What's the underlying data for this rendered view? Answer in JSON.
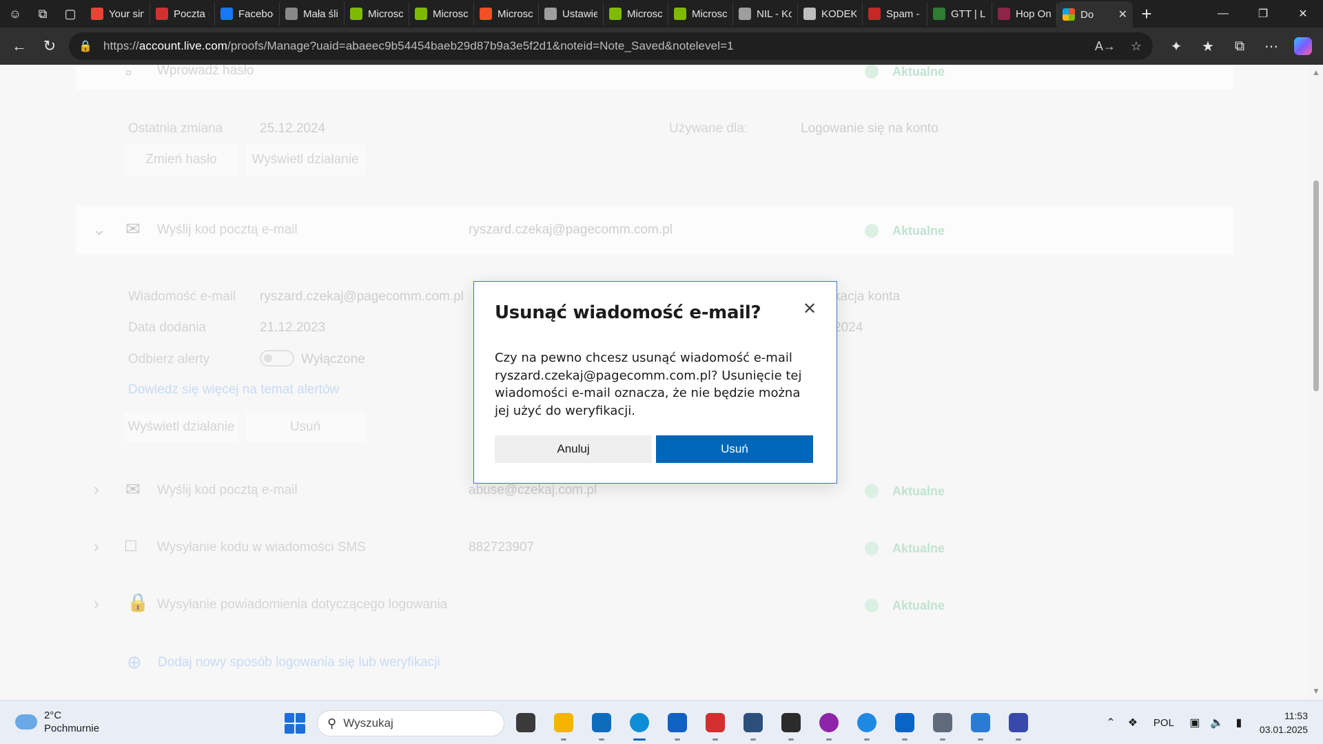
{
  "browser": {
    "tabs": [
      {
        "title": "Your sin",
        "color": "#ea4335"
      },
      {
        "title": "Poczta -",
        "color": "#d32f2f"
      },
      {
        "title": "Faceboo",
        "color": "#1877f2"
      },
      {
        "title": "Mała śli",
        "color": "#888888"
      },
      {
        "title": "Microsc",
        "color": "#7fba00"
      },
      {
        "title": "Microsc",
        "color": "#7fba00"
      },
      {
        "title": "Microsc",
        "color": "#f25022"
      },
      {
        "title": "Ustawie",
        "color": "#9e9e9e"
      },
      {
        "title": "Microsc",
        "color": "#7fba00"
      },
      {
        "title": "Microsc",
        "color": "#7fba00"
      },
      {
        "title": "NIL - Ko",
        "color": "#9e9e9e"
      },
      {
        "title": "KODEKS",
        "color": "#bdbdbd"
      },
      {
        "title": "Spam -",
        "color": "#c62828"
      },
      {
        "title": "GTT | Le",
        "color": "#2e7d32"
      },
      {
        "title": "Hop On",
        "color": "#8e2447"
      }
    ],
    "active_tab": {
      "title": "Do"
    },
    "url_prefix": "https://",
    "url_host": "account.live.com",
    "url_rest": "/proofs/Manage?uaid=abaeec9b54454baeb29d87b9a3e5f2d1&noteid=Note_Saved&notelevel=1"
  },
  "page": {
    "password_row": {
      "label": "Wprowadź hasło",
      "status": "Aktualne"
    },
    "password_details": {
      "last_changed_label": "Ostatnia zmiana",
      "last_changed_value": "25.12.2024",
      "used_for_label": "Używane dla:",
      "used_for_value": "Logowanie się na konto",
      "change_btn": "Zmień hasło",
      "activity_btn": "Wyświetl działanie"
    },
    "email_row_1": {
      "label": "Wyślij kod pocztą e-mail",
      "value": "ryszard.czekaj@pagecomm.com.pl",
      "status": "Aktualne"
    },
    "email_details": {
      "email_label": "Wiadomość e-mail",
      "email_value": "ryszard.czekaj@pagecomm.com.pl",
      "date_label": "Data dodania",
      "date_value": "21.12.2023",
      "alerts_label": "Odbierz alerty",
      "alerts_value": "Wyłączone",
      "learn_more": "Dowiedz się więcej na temat alertów",
      "used_for_partial": "kacja konta",
      "date_partial": "2024",
      "activity_btn": "Wyświetl działanie",
      "remove_btn": "Usuń"
    },
    "email_row_2": {
      "label": "Wyślij kod pocztą e-mail",
      "value": "abuse@czekaj.com.pl",
      "status": "Aktualne"
    },
    "sms_row": {
      "label": "Wysyłanie kodu w wiadomości SMS",
      "value": "882723907",
      "status": "Aktualne"
    },
    "push_row": {
      "label": "Wysyłanie powiadomienia dotyczącego logowania",
      "status": "Aktualne"
    },
    "add_method": "Dodaj nowy sposób logowania się lub weryfikacji"
  },
  "dialog": {
    "title": "Usunąć wiadomość e-mail?",
    "body": "Czy na pewno chcesz usunąć wiadomość e-mail ryszard.czekaj@pagecomm.com.pl? Usunięcie tej wiadomości e-mail oznacza, że nie będzie można jej użyć do weryfikacji.",
    "cancel": "Anuluj",
    "confirm": "Usuń"
  },
  "taskbar": {
    "weather_temp": "2°C",
    "weather_desc": "Pochmurnie",
    "search_placeholder": "Wyszukaj",
    "language": "POL",
    "time": "11:53",
    "date": "03.01.2025",
    "apps": [
      {
        "name": "task-view",
        "color": "#3a3a3a"
      },
      {
        "name": "file-explorer",
        "color": "#f4b400"
      },
      {
        "name": "outlook",
        "color": "#0f6cbd"
      },
      {
        "name": "edge",
        "color": "#0c8dd6"
      },
      {
        "name": "store",
        "color": "#1160c4"
      },
      {
        "name": "pdf-app",
        "color": "#d32f2f"
      },
      {
        "name": "virtualbox",
        "color": "#2d4f7c"
      },
      {
        "name": "terminal",
        "color": "#2b2b2b"
      },
      {
        "name": "podcast-app",
        "color": "#8e24aa"
      },
      {
        "name": "firefox-like",
        "color": "#1e88e5"
      },
      {
        "name": "defender",
        "color": "#0a64c8"
      },
      {
        "name": "settings",
        "color": "#5f6b7a"
      },
      {
        "name": "monitor-app",
        "color": "#2a7bd3"
      },
      {
        "name": "save-app",
        "color": "#3949ab"
      }
    ]
  }
}
